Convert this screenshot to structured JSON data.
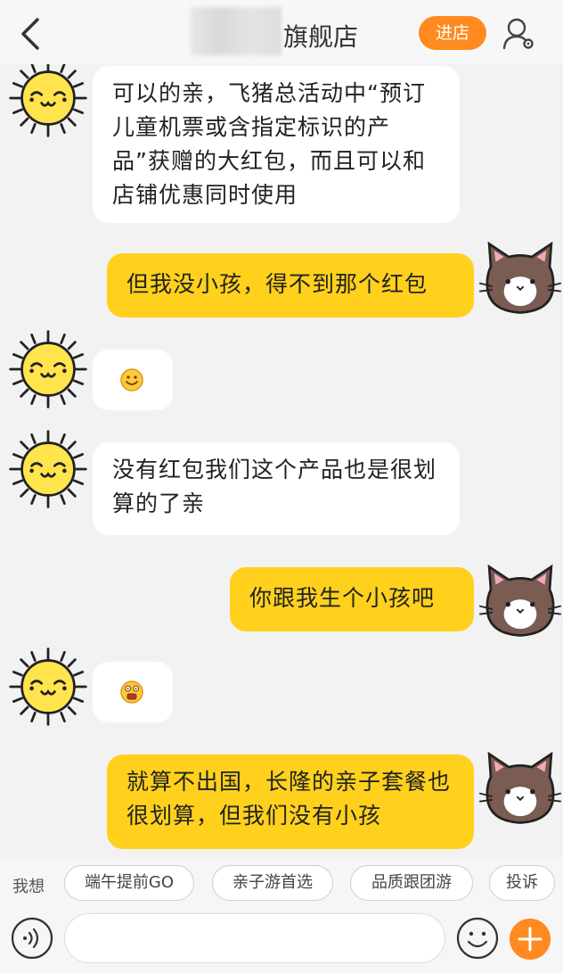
{
  "header": {
    "shop_name": "旗舰店",
    "enter_store_label": "进店"
  },
  "messages": [
    {
      "side": "left",
      "text": "可以的亲，飞猪总活动中“预订儿童机票或含指定标识的产品”获赠的大红包，而且可以和店铺优惠同时使用"
    },
    {
      "side": "right",
      "text": "但我没小孩，得不到那个红包"
    },
    {
      "side": "left",
      "type": "emoji",
      "icon": "smile-emoji-icon"
    },
    {
      "side": "left",
      "text": "没有红包我们这个产品也是很划算的了亲"
    },
    {
      "side": "right",
      "text": "你跟我生个小孩吧"
    },
    {
      "side": "left",
      "type": "emoji",
      "icon": "shocked-emoji-icon"
    },
    {
      "side": "right",
      "text": "就算不出国，长隆的亲子套餐也很划算，但我们没有小孩"
    }
  ],
  "suggestions": {
    "label": "我想",
    "chips": [
      "端午提前GO",
      "亲子游首选",
      "品质跟团游",
      "投诉"
    ]
  },
  "input": {
    "placeholder": ""
  },
  "colors": {
    "accent": "#ff8a1f",
    "right_bubble": "#ffd11c",
    "left_bubble": "#ffffff",
    "background": "#f2f2f2"
  }
}
